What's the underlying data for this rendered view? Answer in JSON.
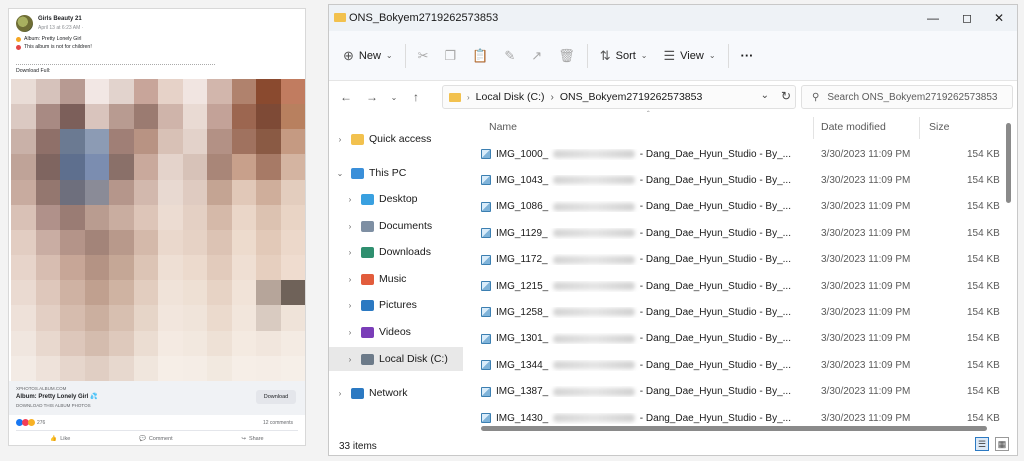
{
  "fb_post": {
    "page_name": "Girls Beauty 21",
    "timestamp": "April 13 at 6:23 AM ·",
    "album_line": "Album: Pretty Lonely Girl",
    "warning_line": "This album is not for children!",
    "download_text": "Download Full:",
    "link_domain": "XPHOTOS.ALBUM.COM",
    "link_title": "Album: Pretty Lonely Girl 💦",
    "link_subtitle": "DOWNLOAD THIS ALBUM PHOTOS",
    "download_button": "Download",
    "reaction_count": "276",
    "comments": "12 comments",
    "actions": {
      "like": "Like",
      "comment": "Comment",
      "share": "Share"
    },
    "pixel_colors": [
      "#e9dcd6",
      "#d6c2bb",
      "#b79a92",
      "#f2e7e4",
      "#e2d3cd",
      "#c8a59a",
      "#e6d2c8",
      "#f1e5e1",
      "#d2b6ac",
      "#b0826d",
      "#8a4a2f",
      "#c17c60",
      "#dbc9c2",
      "#a88a83",
      "#7c5f5a",
      "#d9c4bd",
      "#b89b91",
      "#9b7b71",
      "#cfb4aa",
      "#e9dad3",
      "#c3a298",
      "#9c6650",
      "#7e4a36",
      "#b8805f",
      "#c9b1a8",
      "#8f7069",
      "#6b7a92",
      "#8c9bb4",
      "#a07f76",
      "#b89383",
      "#d8c1b6",
      "#e3d2ca",
      "#b39185",
      "#a0725f",
      "#8a5a44",
      "#c59a82",
      "#bfa398",
      "#7f6560",
      "#5e6f8e",
      "#7b8db0",
      "#8a7069",
      "#c9a99c",
      "#e4d3cb",
      "#d7c2b8",
      "#a98678",
      "#c8a08b",
      "#a77a66",
      "#d4b4a1",
      "#c8ab9f",
      "#94776f",
      "#6e6f7d",
      "#8a8b97",
      "#b5968b",
      "#d2b8ad",
      "#e8d9d1",
      "#dfcbc1",
      "#c4a493",
      "#e1c8b8",
      "#cfae9b",
      "#e3cdbe",
      "#d9c1b6",
      "#b0918a",
      "#9a7c74",
      "#b99c90",
      "#c9ada0",
      "#ddc5b8",
      "#ecdcd2",
      "#e4d0c4",
      "#d5b9a9",
      "#ead6c8",
      "#dcc2b1",
      "#e9d4c5",
      "#e2cdc2",
      "#c9ada3",
      "#b49489",
      "#a38479",
      "#b8998b",
      "#d4b9aa",
      "#ead8cc",
      "#e6d2c5",
      "#dcc3b4",
      "#eddbcd",
      "#e2c9b8",
      "#ecd8ca",
      "#e7d4ca",
      "#d7bdb1",
      "#c7a697",
      "#b49384",
      "#c5a796",
      "#dcc4b5",
      "#eedfd4",
      "#ecdacd",
      "#e2cbbc",
      "#efdfd3",
      "#e6cfbf",
      "#efdccf",
      "#eadad1",
      "#dec7bb",
      "#cfb2a3",
      "#c0a08f",
      "#cfb3a2",
      "#e2cdbf",
      "#f0e3d9",
      "#eee0d4",
      "#e7d3c5",
      "#f1e3d8",
      "#b6a59a",
      "#6f6259",
      "#eee1d9",
      "#e3cfc4",
      "#d6bcae",
      "#cbaf9f",
      "#d7bfb0",
      "#e6d5c8",
      "#f2e6dd",
      "#f0e4da",
      "#ebdacd",
      "#f2e6dc",
      "#d9cbc1",
      "#efe3d9",
      "#f0e6df",
      "#e8d8ce",
      "#ddc7bb",
      "#d4bcae",
      "#dec9bc",
      "#ebddd2",
      "#f4eae2",
      "#f2e8df",
      "#eee1d6",
      "#f4eae1",
      "#f1e6dd",
      "#f4ebe3",
      "#f3ebe5",
      "#eee2da",
      "#e6d6cc",
      "#e0cec3",
      "#e7d8ce",
      "#f0e6dd",
      "#f6eee7",
      "#f5ede6",
      "#f2e9e0",
      "#f6eee7",
      "#f5ede6",
      "#f6efe8"
    ]
  },
  "explorer": {
    "window_title": "ONS_Bokyem2719262573853",
    "commands": {
      "new": "New",
      "sort": "Sort",
      "view": "View",
      "more": "···"
    },
    "address": {
      "drive": "Local Disk (C:)",
      "folder": "ONS_Bokyem2719262573853"
    },
    "search_placeholder": "Search ONS_Bokyem2719262573853",
    "sidebar": [
      {
        "label": "Quick access",
        "icon": "star-icon",
        "color": "#f2c14e"
      },
      {
        "label": "This PC",
        "icon": "computer-icon",
        "color": "#3a8fd9"
      },
      {
        "label": "Desktop",
        "icon": "desktop-icon",
        "color": "#39a0e0"
      },
      {
        "label": "Documents",
        "icon": "documents-icon",
        "color": "#7e8fa3"
      },
      {
        "label": "Downloads",
        "icon": "downloads-icon",
        "color": "#2f8f6f"
      },
      {
        "label": "Music",
        "icon": "music-icon",
        "color": "#e25c3c"
      },
      {
        "label": "Pictures",
        "icon": "pictures-icon",
        "color": "#2b79c2"
      },
      {
        "label": "Videos",
        "icon": "videos-icon",
        "color": "#7a3db8"
      },
      {
        "label": "Local Disk (C:)",
        "icon": "drive-icon",
        "color": "#6c7a89"
      },
      {
        "label": "Network",
        "icon": "network-icon",
        "color": "#2b79c2"
      }
    ],
    "columns": {
      "name": "Name",
      "date": "Date modified",
      "size": "Size"
    },
    "files": [
      {
        "prefix": "IMG_1000_",
        "suffix": "- Dang_Dae_Hyun_Studio - By_...",
        "date": "3/30/2023 11:09 PM",
        "size": "154 KB"
      },
      {
        "prefix": "IMG_1043_",
        "suffix": "- Dang_Dae_Hyun_Studio - By_...",
        "date": "3/30/2023 11:09 PM",
        "size": "154 KB"
      },
      {
        "prefix": "IMG_1086_",
        "suffix": "- Dang_Dae_Hyun_Studio - By_...",
        "date": "3/30/2023 11:09 PM",
        "size": "154 KB"
      },
      {
        "prefix": "IMG_1129_",
        "suffix": "- Dang_Dae_Hyun_Studio - By_...",
        "date": "3/30/2023 11:09 PM",
        "size": "154 KB"
      },
      {
        "prefix": "IMG_1172_",
        "suffix": "- Dang_Dae_Hyun_Studio - By_...",
        "date": "3/30/2023 11:09 PM",
        "size": "154 KB"
      },
      {
        "prefix": "IMG_1215_",
        "suffix": "- Dang_Dae_Hyun_Studio - By_...",
        "date": "3/30/2023 11:09 PM",
        "size": "154 KB"
      },
      {
        "prefix": "IMG_1258_",
        "suffix": "- Dang_Dae_Hyun_Studio - By_...",
        "date": "3/30/2023 11:09 PM",
        "size": "154 KB"
      },
      {
        "prefix": "IMG_1301_",
        "suffix": "- Dang_Dae_Hyun_Studio - By_...",
        "date": "3/30/2023 11:09 PM",
        "size": "154 KB"
      },
      {
        "prefix": "IMG_1344_",
        "suffix": "- Dang_Dae_Hyun_Studio - By_...",
        "date": "3/30/2023 11:09 PM",
        "size": "154 KB"
      },
      {
        "prefix": "IMG_1387_",
        "suffix": "- Dang_Dae_Hyun_Studio - By_...",
        "date": "3/30/2023 11:09 PM",
        "size": "154 KB"
      },
      {
        "prefix": "IMG_1430_",
        "suffix": "- Dang_Dae_Hyun_Studio - By_...",
        "date": "3/30/2023 11:09 PM",
        "size": "154 KB"
      }
    ],
    "status": "33 items"
  }
}
